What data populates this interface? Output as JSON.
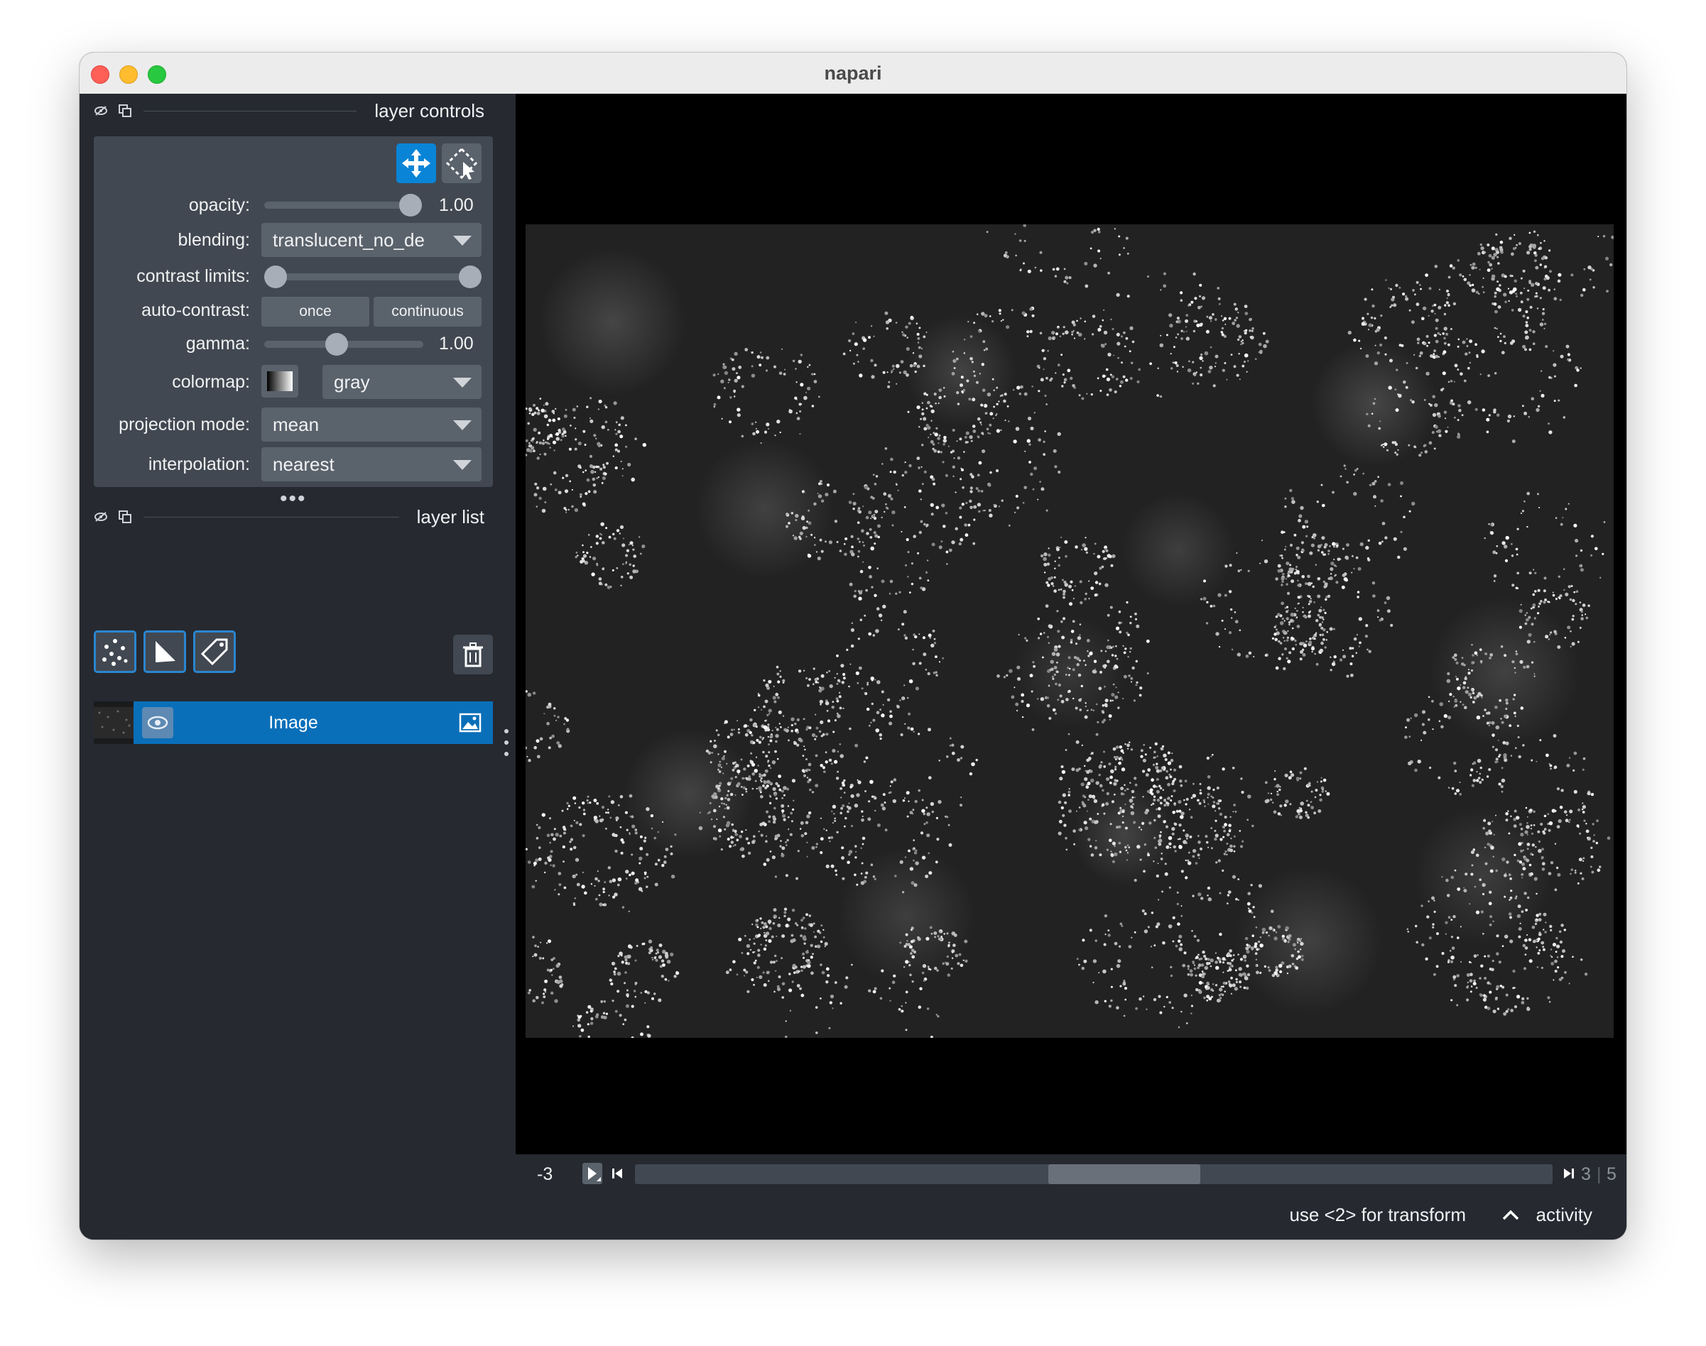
{
  "window": {
    "title": "napari"
  },
  "layer_controls": {
    "title": "layer controls",
    "opacity": {
      "label": "opacity:",
      "value": "1.00",
      "level": 1.0
    },
    "blending": {
      "label": "blending:",
      "value": "translucent_no_de"
    },
    "contrast_limits": {
      "label": "contrast limits:",
      "low": 0.0,
      "high": 1.0
    },
    "auto_contrast": {
      "label": "auto-contrast:",
      "once": "once",
      "continuous": "continuous"
    },
    "gamma": {
      "label": "gamma:",
      "value": "1.00",
      "level": 0.45
    },
    "colormap": {
      "label": "colormap:",
      "value": "gray"
    },
    "projection_mode": {
      "label": "projection mode:",
      "value": "mean"
    },
    "interpolation": {
      "label": "interpolation:",
      "value": "nearest"
    }
  },
  "layer_list": {
    "title": "layer list",
    "layers": [
      {
        "name": "Image",
        "type": "image",
        "visible": true,
        "selected": true
      }
    ]
  },
  "dims": {
    "current": "-3",
    "slider_level": 0.54,
    "numbers": [
      "3",
      "5"
    ]
  },
  "status": {
    "message": "use <2> for transform",
    "activity": "activity"
  },
  "icons": {
    "move": "move-icon",
    "transform": "transform-icon",
    "points": "points-icon",
    "shapes": "shapes-icon",
    "labels": "labels-icon",
    "delete": "trash-icon",
    "console": "console-icon",
    "ndisplay": "ndisplay-icon",
    "roll": "roll-icon",
    "transpose": "transpose-icon",
    "grid": "grid-icon",
    "home": "home-icon"
  },
  "colors": {
    "accent": "#0a84d6",
    "panel": "#414851",
    "background": "#262930",
    "selected_layer": "#0a6fb9"
  }
}
